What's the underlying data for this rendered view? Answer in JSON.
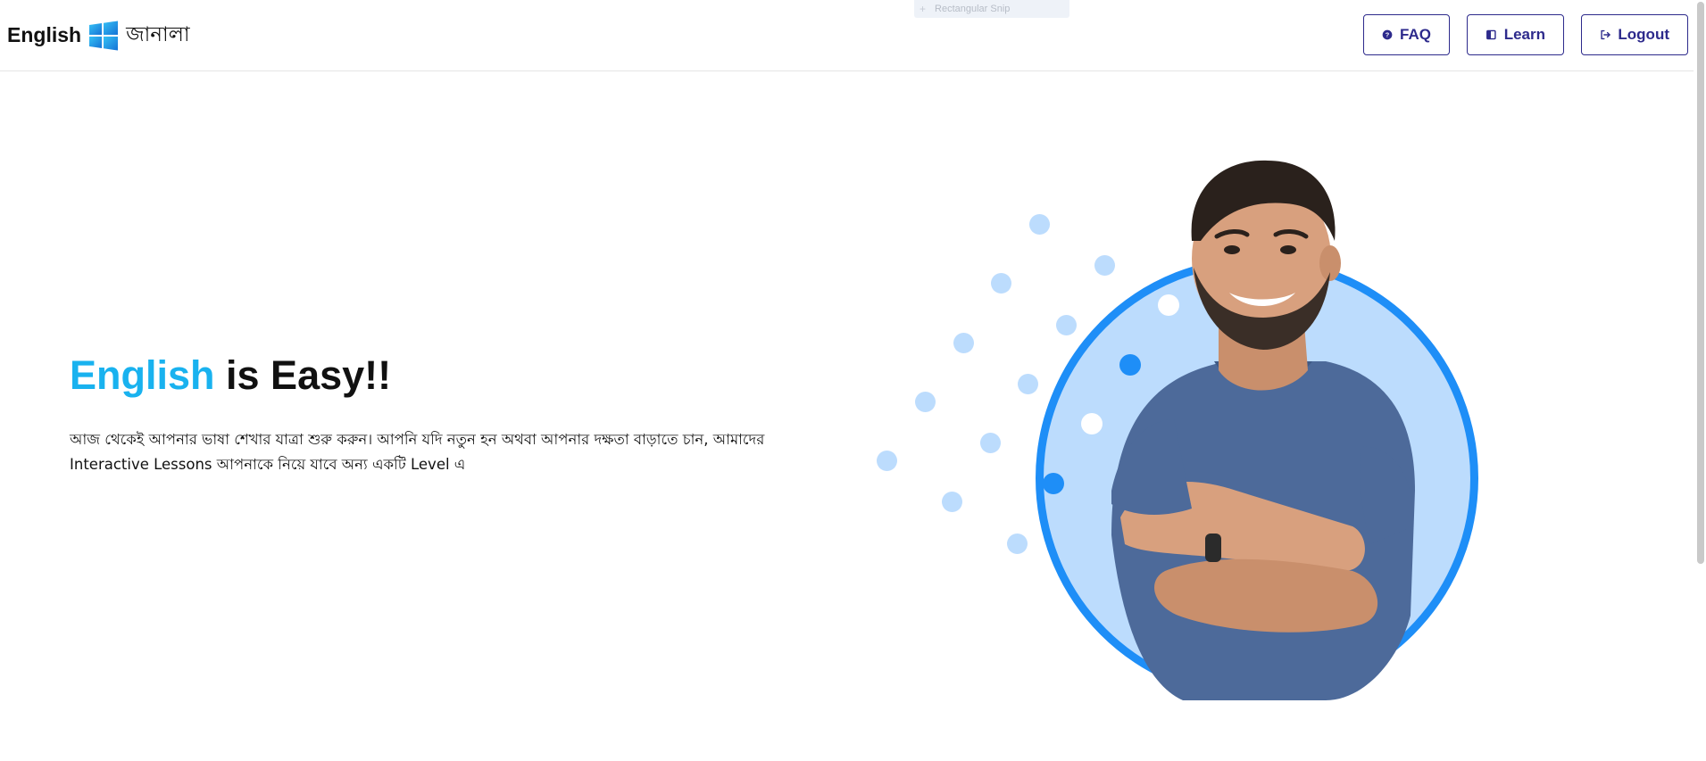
{
  "header": {
    "brand_en": "English",
    "brand_bn": "জানালা",
    "logo_icon": "windows-logo-icon",
    "snip_label": "Rectangular Snip",
    "nav": {
      "faq": "FAQ",
      "learn": "Learn",
      "logout": "Logout"
    }
  },
  "hero": {
    "title_accent": "English",
    "title_rest": " is Easy!!",
    "description": "আজ থেকেই আপনার ভাষা শেখার যাত্রা শুরু করুন। আপনি যদি নতুন হন অথবা আপনার দক্ষতা বাড়াতে চান, আমাদের Interactive Lessons আপনাকে নিয়ে যাবে অন্য একটি Level এ"
  },
  "colors": {
    "accent": "#19b2ef",
    "nav_border": "#2d2a8c",
    "circle_fill": "#bcdcfd",
    "circle_ring": "#1e8ef7",
    "dot_light": "#bcdcfd",
    "dot_dark": "#1e8ef7"
  }
}
